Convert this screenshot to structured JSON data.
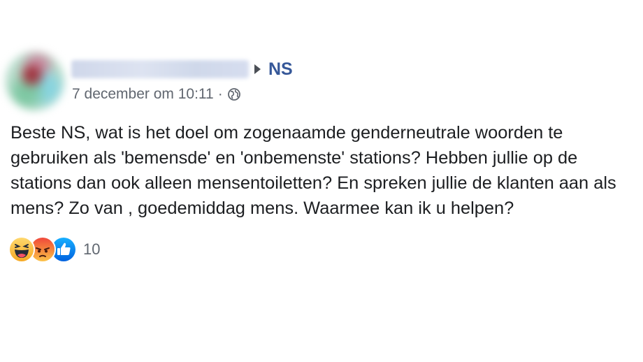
{
  "post": {
    "page_name": "NS",
    "timestamp": "7 december om 10:11",
    "separator": "·",
    "text": "Beste NS, wat is het doel om zogenaamde genderneutrale woorden te gebruiken als 'bemensde' en 'onbemenste' stations? Hebben jullie op de stations dan ook alleen mensentoiletten? En spreken jullie de klanten aan als mens? Zo van , goedemiddag mens. Waarmee kan ik u helpen?",
    "reaction_count": "10",
    "reactions": [
      "haha-icon",
      "angry-icon",
      "like-icon"
    ],
    "privacy_icon": "globe-icon"
  },
  "colors": {
    "link": "#365899",
    "text": "#1c1e21",
    "meta": "#616770"
  }
}
